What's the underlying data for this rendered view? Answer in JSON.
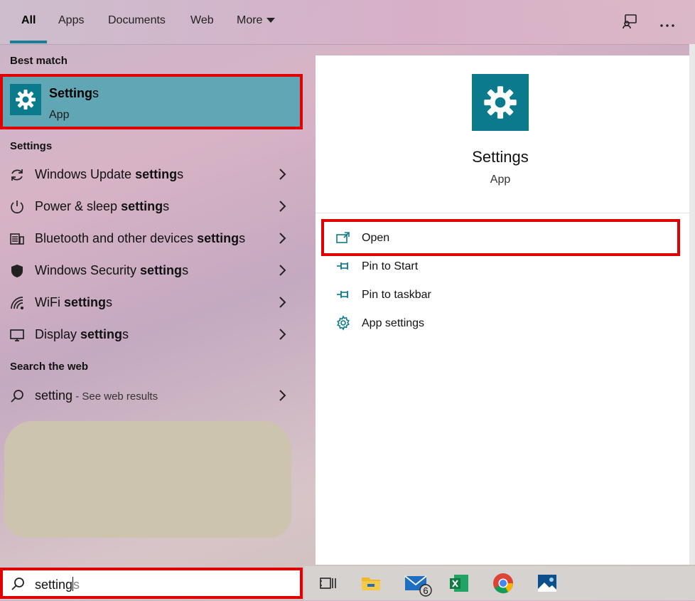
{
  "tabs": [
    {
      "label": "All",
      "active": true
    },
    {
      "label": "Apps"
    },
    {
      "label": "Documents"
    },
    {
      "label": "Web"
    },
    {
      "label": "More"
    }
  ],
  "top_icons": [
    "feedback-icon",
    "more-options-icon"
  ],
  "left": {
    "best_match_header": "Best match",
    "best_match": {
      "title_bold": "Setting",
      "title_rest": "s",
      "subtitle": "App",
      "icon": "gear-icon"
    },
    "settings_header": "Settings",
    "settings_items": [
      {
        "label": "Windows Update ",
        "bold": "setting",
        "rest": "s",
        "icon": "refresh-icon"
      },
      {
        "label": "Power & sleep ",
        "bold": "setting",
        "rest": "s",
        "icon": "power-icon"
      },
      {
        "label": "Bluetooth and other devices ",
        "bold": "setting",
        "rest": "s",
        "icon": "devices-icon"
      },
      {
        "label": "Windows Security ",
        "bold": "setting",
        "rest": "s",
        "icon": "shield-icon"
      },
      {
        "label": "WiFi ",
        "bold": "setting",
        "rest": "s",
        "icon": "wifi-icon"
      },
      {
        "label": "Display ",
        "bold": "setting",
        "rest": "s",
        "icon": "display-icon"
      }
    ],
    "web_header": "Search the web",
    "web_item": {
      "label": "setting",
      "suffix": " - See web results",
      "icon": "search-icon"
    }
  },
  "right": {
    "title": "Settings",
    "subtitle": "App",
    "actions": [
      {
        "label": "Open",
        "icon": "open-icon"
      },
      {
        "label": "Pin to Start",
        "icon": "pin-icon"
      },
      {
        "label": "Pin to taskbar",
        "icon": "pin-icon"
      },
      {
        "label": "App settings",
        "icon": "gear-icon"
      }
    ]
  },
  "search": {
    "typed": "setting",
    "ghost": "s"
  },
  "taskbar": {
    "icons": [
      "task-view-icon",
      "file-explorer-icon",
      "mail-icon",
      "excel-icon",
      "chrome-icon",
      "photos-icon"
    ],
    "mail_badge": "6"
  },
  "colors": {
    "accent": "#0b7a8c",
    "highlight": "#e00000",
    "best_match_bg": "#61a6b4"
  }
}
